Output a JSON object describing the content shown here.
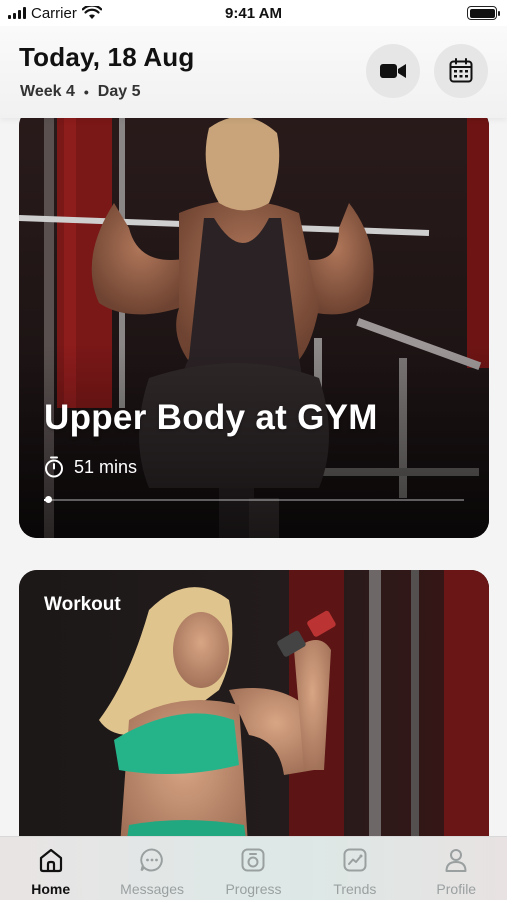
{
  "status_bar": {
    "carrier": "Carrier",
    "time": "9:41 AM"
  },
  "header": {
    "title": "Today, 18 Aug",
    "week": "Week 4",
    "day": "Day 5",
    "separator": "•"
  },
  "cards": [
    {
      "title": "Upper Body at GYM",
      "duration": "51 mins",
      "progress": 0.01
    },
    {
      "label": "Workout"
    }
  ],
  "tabs": [
    {
      "label": "Home",
      "icon": "home-icon",
      "active": true
    },
    {
      "label": "Messages",
      "icon": "messages-icon",
      "active": false
    },
    {
      "label": "Progress",
      "icon": "progress-icon",
      "active": false
    },
    {
      "label": "Trends",
      "icon": "trends-icon",
      "active": false
    },
    {
      "label": "Profile",
      "icon": "profile-icon",
      "active": false
    }
  ],
  "colors": {
    "active": "#111111",
    "inactive": "#9aa0a0",
    "card_bg": "#1a1414",
    "accent_green": "#27b38a"
  }
}
